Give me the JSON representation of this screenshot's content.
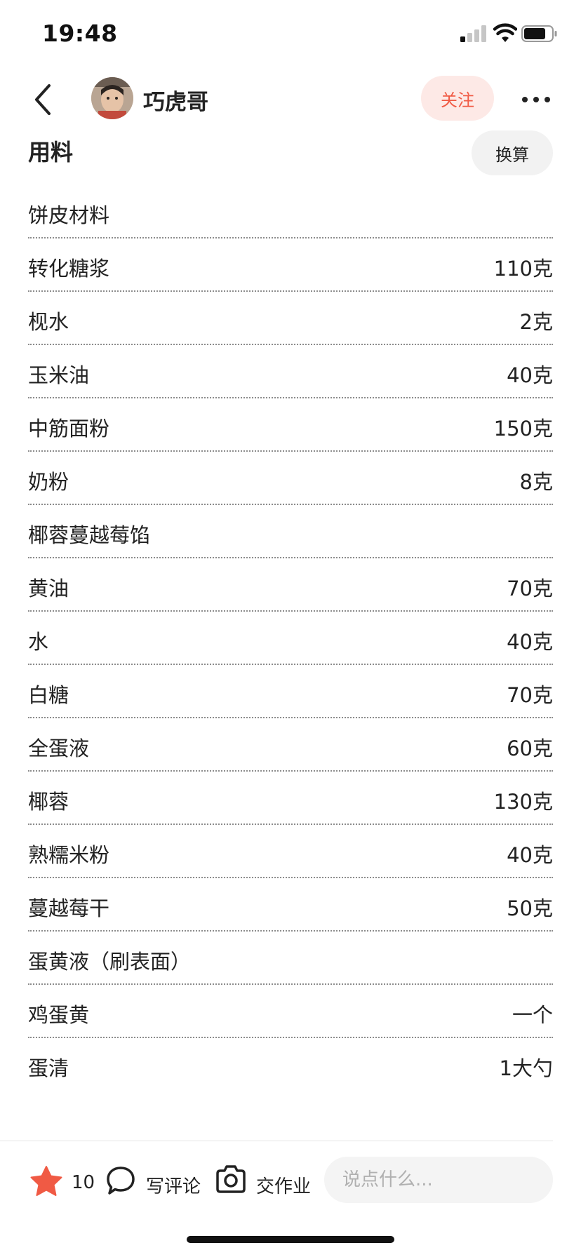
{
  "status_bar": {
    "time": "19:48",
    "icons": [
      "signal-icon",
      "wifi-icon",
      "battery-icon"
    ]
  },
  "header": {
    "author_name": "巧虎哥",
    "follow_label": "关注",
    "icons": [
      "back-chevron-icon",
      "more-dots-icon"
    ]
  },
  "ingredients": {
    "title": "用料",
    "convert_label": "换算",
    "rows": [
      {
        "name": "饼皮材料",
        "amount": ""
      },
      {
        "name": "转化糖浆",
        "amount": "110克"
      },
      {
        "name": "枧水",
        "amount": "2克"
      },
      {
        "name": "玉米油",
        "amount": "40克"
      },
      {
        "name": "中筋面粉",
        "amount": "150克"
      },
      {
        "name": "奶粉",
        "amount": "8克"
      },
      {
        "name": "椰蓉蔓越莓馅",
        "amount": ""
      },
      {
        "name": "黄油",
        "amount": "70克"
      },
      {
        "name": "水",
        "amount": "40克"
      },
      {
        "name": "白糖",
        "amount": "70克"
      },
      {
        "name": "全蛋液",
        "amount": "60克"
      },
      {
        "name": "椰蓉",
        "amount": "130克"
      },
      {
        "name": "熟糯米粉",
        "amount": "40克"
      },
      {
        "name": "蔓越莓干",
        "amount": "50克"
      },
      {
        "name": "蛋黄液（刷表面）",
        "amount": ""
      },
      {
        "name": "鸡蛋黄",
        "amount": "一个"
      },
      {
        "name": "蛋清",
        "amount": "1大勺"
      }
    ]
  },
  "bottom_bar": {
    "like_count": "10",
    "comment_label": "写评论",
    "homework_label": "交作业",
    "input_placeholder": "说点什么...",
    "input_value": "",
    "icons": [
      "star-icon",
      "comment-bubble-icon",
      "camera-icon"
    ]
  },
  "colors": {
    "accent": "#f05a44",
    "follow_bg": "#fde9e6",
    "divider": "#8c8c8c"
  }
}
